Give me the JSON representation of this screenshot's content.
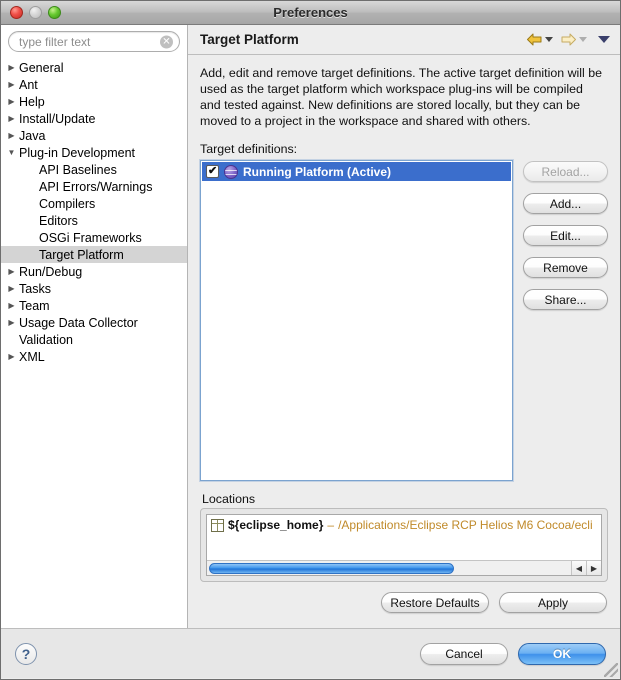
{
  "window": {
    "title": "Preferences",
    "traffic_lights": [
      "close-button",
      "minimize-button",
      "zoom-button"
    ]
  },
  "sidebar": {
    "filter": {
      "value": "",
      "placeholder": "type filter text",
      "clear_glyph": "✕"
    },
    "items": [
      {
        "label": "General",
        "indent": 0,
        "twisty": "collapsed",
        "selected": false
      },
      {
        "label": "Ant",
        "indent": 0,
        "twisty": "collapsed",
        "selected": false
      },
      {
        "label": "Help",
        "indent": 0,
        "twisty": "collapsed",
        "selected": false
      },
      {
        "label": "Install/Update",
        "indent": 0,
        "twisty": "collapsed",
        "selected": false
      },
      {
        "label": "Java",
        "indent": 0,
        "twisty": "collapsed",
        "selected": false
      },
      {
        "label": "Plug-in Development",
        "indent": 0,
        "twisty": "expanded",
        "selected": false
      },
      {
        "label": "API Baselines",
        "indent": 1,
        "twisty": "none",
        "selected": false
      },
      {
        "label": "API Errors/Warnings",
        "indent": 1,
        "twisty": "none",
        "selected": false
      },
      {
        "label": "Compilers",
        "indent": 1,
        "twisty": "none",
        "selected": false
      },
      {
        "label": "Editors",
        "indent": 1,
        "twisty": "none",
        "selected": false
      },
      {
        "label": "OSGi Frameworks",
        "indent": 1,
        "twisty": "none",
        "selected": false
      },
      {
        "label": "Target Platform",
        "indent": 1,
        "twisty": "none",
        "selected": true
      },
      {
        "label": "Run/Debug",
        "indent": 0,
        "twisty": "collapsed",
        "selected": false
      },
      {
        "label": "Tasks",
        "indent": 0,
        "twisty": "collapsed",
        "selected": false
      },
      {
        "label": "Team",
        "indent": 0,
        "twisty": "collapsed",
        "selected": false
      },
      {
        "label": "Usage Data Collector",
        "indent": 0,
        "twisty": "collapsed",
        "selected": false
      },
      {
        "label": "Validation",
        "indent": 0,
        "twisty": "none",
        "selected": false
      },
      {
        "label": "XML",
        "indent": 0,
        "twisty": "collapsed",
        "selected": false
      }
    ]
  },
  "page": {
    "title": "Target Platform",
    "description": "Add, edit and remove target definitions.  The active target definition will be used as the target platform which workspace plug-ins will be compiled and tested against.  New definitions are stored locally, but they can be moved to a project in the workspace and shared with others.",
    "nav": {
      "back_icon": "back-arrow-icon",
      "forward_icon": "forward-arrow-icon",
      "menu_icon": "chevron-down-icon"
    },
    "target_definitions": {
      "label": "Target definitions:",
      "rows": [
        {
          "label": "Running Platform (Active)",
          "checked": true,
          "selected": true,
          "icon": "target-platform-icon"
        }
      ]
    },
    "side_buttons": [
      {
        "label": "Reload...",
        "enabled": false
      },
      {
        "label": "Add...",
        "enabled": true
      },
      {
        "label": "Edit...",
        "enabled": true
      },
      {
        "label": "Remove",
        "enabled": true
      },
      {
        "label": "Share...",
        "enabled": true
      }
    ],
    "locations": {
      "label": "Locations",
      "rows": [
        {
          "icon": "directory-icon",
          "variable": "${eclipse_home}",
          "separator": " – ",
          "path": "/Applications/Eclipse RCP Helios M6 Cocoa/ecli"
        }
      ],
      "scrollbar": {
        "left_arrow": "◀",
        "right_arrow": "▶"
      }
    },
    "bottom_actions": [
      {
        "label": "Restore Defaults"
      },
      {
        "label": "Apply"
      }
    ]
  },
  "footer": {
    "help_label": "?",
    "cancel_label": "Cancel",
    "ok_label": "OK"
  },
  "colors": {
    "selection_blue": "#3b6ecc",
    "default_button_blue": "#3e90ea",
    "path_orange": "#c08a2a",
    "tree_selected_gray": "#d4d4d4"
  }
}
